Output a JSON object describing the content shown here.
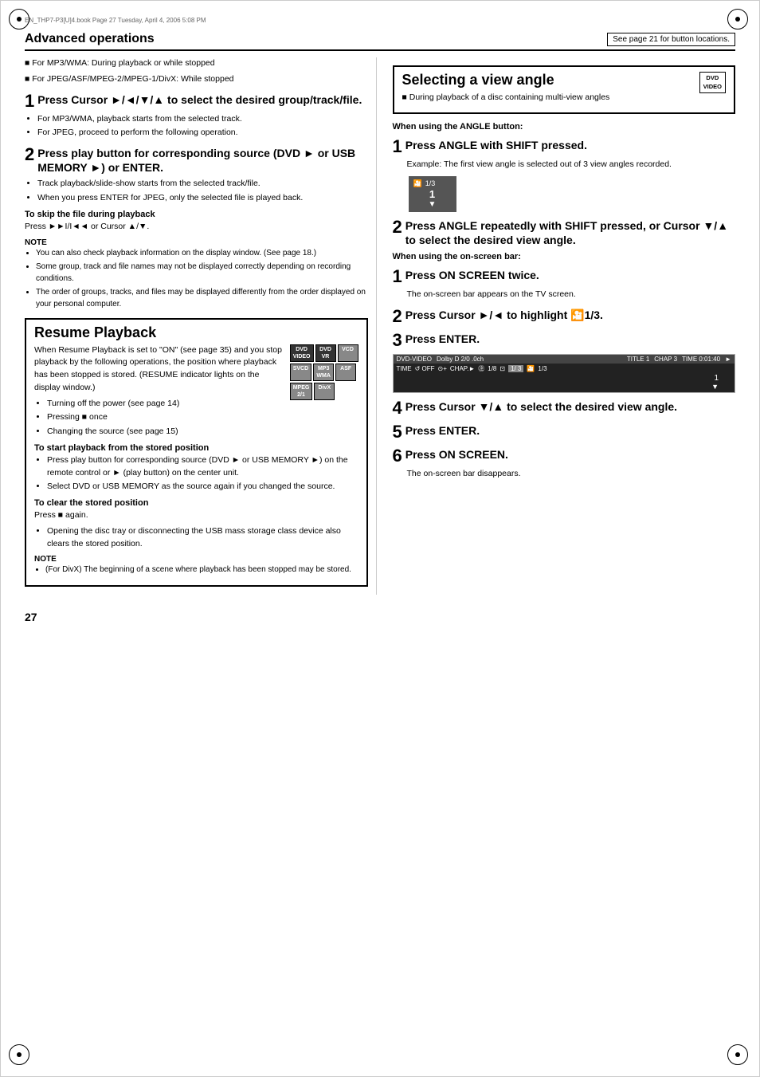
{
  "page": {
    "number": "27",
    "file_path": "EN_THP7-P3[U]4.book  Page 27  Tuesday, April 4, 2006  5:08 PM"
  },
  "header": {
    "section_title": "Advanced operations",
    "page_ref": "See page 21 for button locations."
  },
  "left_col": {
    "intro_lines": [
      "■ For MP3/WMA: During playback or while stopped",
      "■ For JPEG/ASF/MPEG-2/MPEG-1/DivX: While stopped"
    ],
    "step1": {
      "number": "1",
      "text": "Press Cursor ►/◄/▼/▲ to select the desired group/track/file.",
      "bullets": [
        "For MP3/WMA, playback starts from the selected track.",
        "For JPEG, proceed to perform the following operation."
      ]
    },
    "step2": {
      "number": "2",
      "text": "Press play button for corresponding source (DVD ► or USB MEMORY ►) or ENTER.",
      "bullets": [
        "Track playback/slide-show starts from the selected track/file.",
        "When you press ENTER for JPEG, only the selected file is played back."
      ]
    },
    "skip_section": {
      "header": "To skip the file during playback",
      "text": "Press ►►I/I◄◄ or Cursor ▲/▼."
    },
    "note_section": {
      "label": "NOTE",
      "items": [
        "You can also check playback information on the display window. (See page 18.)",
        "Some group, track and file names may not be displayed correctly depending on recording conditions.",
        "The order of groups, tracks, and files may be displayed differently from the order displayed on your personal computer."
      ]
    },
    "resume_section": {
      "title": "Resume Playback",
      "intro": "When Resume Playback is set to \"ON\" (see page 35) and you stop playback by the following operations, the position where playback has been stopped is stored. (RESUME indicator lights on the display window.)",
      "bullets": [
        "Turning off the power (see page 14)",
        "Pressing ■ once",
        "Changing the source (see page 15)"
      ],
      "formats": {
        "row1": [
          {
            "label": "DVD\nVIDEO",
            "style": "dark"
          },
          {
            "label": "DVD\nVR",
            "style": "dark"
          },
          {
            "label": "VCD",
            "style": "medium"
          }
        ],
        "row2": [
          {
            "label": "SVCD",
            "style": "medium"
          },
          {
            "label": "MP3\nWMA",
            "style": "medium"
          },
          {
            "label": "ASF",
            "style": "medium"
          }
        ],
        "row3": [
          {
            "label": "MPEG\n2/1",
            "style": "medium"
          },
          {
            "label": "DivX",
            "style": "medium"
          }
        ]
      },
      "stored_position": {
        "header": "To start playback from the stored position",
        "bullets": [
          "Press play button for corresponding source (DVD ► or USB MEMORY ►) on the remote control or ► (play button) on the center unit.",
          "Select DVD or USB MEMORY as the source again if you changed the source."
        ]
      },
      "clear_position": {
        "header": "To clear the stored position",
        "text": "Press ■ again.",
        "bullets": [
          "Opening the disc tray or disconnecting the USB mass storage class device also clears the stored position."
        ]
      },
      "note2": {
        "label": "NOTE",
        "items": [
          "(For DivX) The beginning of a scene where playback has been stopped may be stored."
        ]
      }
    }
  },
  "right_col": {
    "title": "Selecting a view angle",
    "dvd_badge": {
      "line1": "DVD",
      "line2": "VIDEO"
    },
    "intro": "■ During playback of a disc containing multi-view angles",
    "angle_button_section": {
      "header": "When using the ANGLE button:",
      "step1": {
        "number": "1",
        "text": "Press ANGLE with SHIFT pressed.",
        "note": "Example: The first view angle is selected out of 3 view angles recorded."
      },
      "angle_display": {
        "icon": "🎦",
        "fraction": "1/3",
        "number": "1"
      },
      "step2": {
        "number": "2",
        "text": "Press ANGLE repeatedly with SHIFT pressed, or Cursor ▼/▲ to select the desired view angle."
      }
    },
    "onscreen_section": {
      "header": "When using the on-screen bar:",
      "step1": {
        "number": "1",
        "text": "Press ON SCREEN twice.",
        "note": "The on-screen bar appears on the TV screen."
      },
      "step2": {
        "number": "2",
        "text": "Press Cursor ►/◄ to highlight 🎦1/3."
      },
      "step3": {
        "number": "3",
        "text": "Press ENTER.",
        "bar_top": "DVD-VIDEO  Dolby D 2/0 .0ch    TITLE 1  CHAP 3  TIME  0:01:40  ►",
        "bar_bottom": "TIME  ↺ OFF  ⊙+  CHAP.►  ㊟  1/8  ⊡  1/ 3  🎦  1/3"
      },
      "step4": {
        "number": "4",
        "text": "Press Cursor ▼/▲  to select the desired view angle."
      },
      "step5": {
        "number": "5",
        "text": "Press ENTER."
      },
      "step6": {
        "number": "6",
        "text": "Press ON SCREEN.",
        "note": "The on-screen bar disappears."
      }
    }
  }
}
